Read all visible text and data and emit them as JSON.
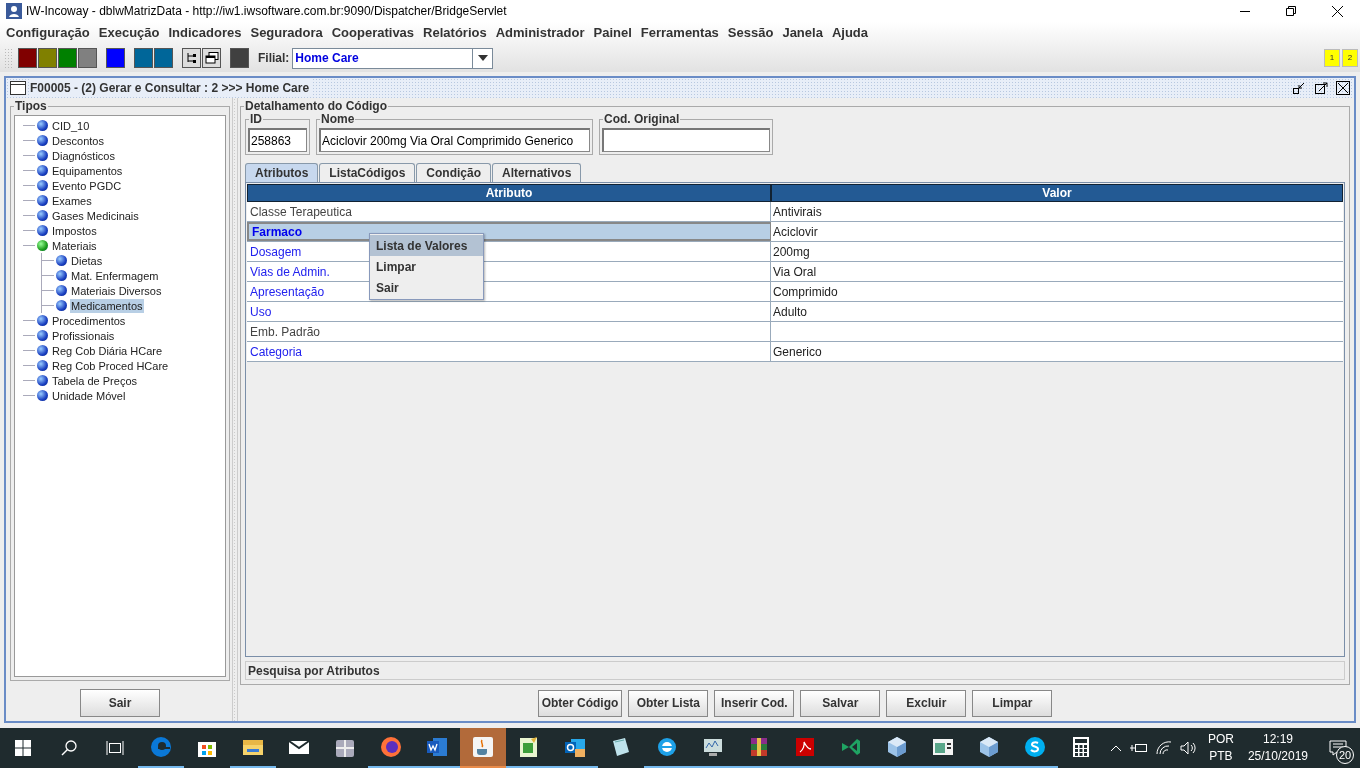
{
  "window": {
    "title": "IW-Incoway - dblwMatrizData - http://iw1.iwsoftware.com.br:9090/Dispatcher/BridgeServlet"
  },
  "menu": [
    "Configuração",
    "Execução",
    "Indicadores",
    "Seguradora",
    "Cooperativas",
    "Relatórios",
    "Administrador",
    "Painel",
    "Ferramentas",
    "Sessão",
    "Janela",
    "Ajuda"
  ],
  "toolbar": {
    "groups": [
      [
        {
          "kind": "swatch",
          "color": "#800000"
        },
        {
          "kind": "swatch",
          "color": "#808000"
        },
        {
          "kind": "swatch",
          "color": "#008000"
        },
        {
          "kind": "swatch",
          "color": "#808080"
        }
      ],
      [
        {
          "kind": "swatch",
          "color": "#0000ff"
        }
      ],
      [
        {
          "kind": "swatch",
          "color": "#006699"
        },
        {
          "kind": "swatch",
          "color": "#006699"
        }
      ],
      [
        {
          "kind": "tree"
        },
        {
          "kind": "windows"
        }
      ],
      [
        {
          "kind": "swatch",
          "color": "#404040"
        }
      ]
    ],
    "filial_label": "Filial:",
    "filial_value": "Home Care",
    "badges": [
      "1",
      "2"
    ]
  },
  "frame": {
    "title": "F00005 - (2) Gerar e Consultar : 2 >>> Home Care"
  },
  "tipos": {
    "title": "Tipos",
    "items": [
      {
        "label": "CID_10",
        "expanded": false,
        "selected": false
      },
      {
        "label": "Descontos",
        "expanded": false,
        "selected": false
      },
      {
        "label": "Diagnósticos",
        "expanded": false,
        "selected": false
      },
      {
        "label": "Equipamentos",
        "expanded": false,
        "selected": false
      },
      {
        "label": "Evento PGDC",
        "expanded": false,
        "selected": false
      },
      {
        "label": "Exames",
        "expanded": false,
        "selected": false
      },
      {
        "label": "Gases Medicinais",
        "expanded": false,
        "selected": false
      },
      {
        "label": "Impostos",
        "expanded": false,
        "selected": false
      },
      {
        "label": "Materiais",
        "expanded": true,
        "selected": false,
        "children": [
          {
            "label": "Dietas",
            "expanded": false,
            "selected": false
          },
          {
            "label": "Mat. Enfermagem",
            "expanded": false,
            "selected": false
          },
          {
            "label": "Materiais Diversos",
            "expanded": false,
            "selected": false
          },
          {
            "label": "Medicamentos",
            "expanded": false,
            "selected": true
          }
        ]
      },
      {
        "label": "Procedimentos",
        "expanded": false,
        "selected": false
      },
      {
        "label": "Profissionais",
        "expanded": false,
        "selected": false
      },
      {
        "label": "Reg Cob Diária HCare",
        "expanded": false,
        "selected": false
      },
      {
        "label": "Reg Cob Proced HCare",
        "expanded": false,
        "selected": false
      },
      {
        "label": "Tabela de Preços",
        "expanded": false,
        "selected": false
      },
      {
        "label": "Unidade Móvel",
        "expanded": false,
        "selected": false
      }
    ],
    "button": "Sair"
  },
  "detail": {
    "title": "Detalhamento do Código",
    "fields": [
      {
        "label": "ID",
        "value": "258863"
      },
      {
        "label": "Nome",
        "value": "Aciclovir 200mg Via Oral Comprimido Generico"
      },
      {
        "label": "Cod. Original"
      }
    ]
  },
  "tabs": [
    {
      "label": "Atributos",
      "selected": true
    },
    {
      "label": "ListaCódigos",
      "selected": false
    },
    {
      "label": "Condição",
      "selected": false
    },
    {
      "label": "Alternativos",
      "selected": false
    }
  ],
  "table": {
    "columns": [
      "Atributo",
      "Valor"
    ],
    "rows": [
      {
        "attribute": "Classe Terapeutica",
        "value": "Antivirais",
        "linked": false,
        "selected": false
      },
      {
        "attribute": "Farmaco",
        "value": "Aciclovir",
        "linked": true,
        "selected": true
      },
      {
        "attribute": "Dosagem",
        "value": "200mg",
        "linked": true,
        "selected": false
      },
      {
        "attribute": "Vias de Admin.",
        "value": "Via Oral",
        "linked": true,
        "selected": false
      },
      {
        "attribute": "Apresentação",
        "value": "Comprimido",
        "linked": true,
        "selected": false
      },
      {
        "attribute": "Uso",
        "value": "Adulto",
        "linked": true,
        "selected": false
      },
      {
        "attribute": "Emb. Padrão",
        "linked": false,
        "selected": false
      },
      {
        "attribute": "Categoria",
        "value": "Generico",
        "linked": true,
        "selected": false
      }
    ]
  },
  "context_menu": [
    {
      "label": "Lista de Valores",
      "selected": true
    },
    {
      "label": "Limpar",
      "selected": false
    },
    {
      "label": "Sair",
      "selected": false
    }
  ],
  "search_bar": {
    "title": "Pesquisa por Atributos"
  },
  "buttons": [
    "Obter Código",
    "Obter Lista",
    "Inserir Cod.",
    "Salvar",
    "Excluir",
    "Limpar"
  ],
  "taskbar": {
    "apps": [
      {
        "kind": "edge",
        "running": true,
        "selected": false
      },
      {
        "kind": "store",
        "running": false,
        "selected": false
      },
      {
        "kind": "folder",
        "running": true,
        "selected": false
      },
      {
        "kind": "mail",
        "running": false,
        "selected": false
      },
      {
        "kind": "gift",
        "running": false,
        "selected": false
      },
      {
        "kind": "firefox",
        "running": true,
        "selected": false
      },
      {
        "kind": "word",
        "running": true,
        "selected": false
      },
      {
        "kind": "java",
        "running": true,
        "selected": true
      },
      {
        "kind": "notes",
        "running": true,
        "selected": false
      },
      {
        "kind": "outlook",
        "running": true,
        "selected": false
      },
      {
        "kind": "notepad",
        "running": false,
        "selected": false
      },
      {
        "kind": "ie",
        "running": true,
        "selected": false
      },
      {
        "kind": "monitor",
        "running": true,
        "selected": false
      },
      {
        "kind": "winrar",
        "running": true,
        "selected": false
      },
      {
        "kind": "pdf",
        "running": true,
        "selected": false
      },
      {
        "kind": "vs",
        "running": true,
        "selected": false
      },
      {
        "kind": "cube",
        "running": true,
        "selected": false
      },
      {
        "kind": "panel",
        "running": true,
        "selected": false
      },
      {
        "kind": "cube",
        "running": true,
        "selected": false
      },
      {
        "kind": "skype",
        "running": true,
        "selected": false
      },
      {
        "kind": "calculator",
        "running": false,
        "selected": false
      }
    ],
    "language": [
      "POR",
      "PTB"
    ],
    "time": "12:19",
    "date": "25/10/2019",
    "notifications": "20"
  }
}
